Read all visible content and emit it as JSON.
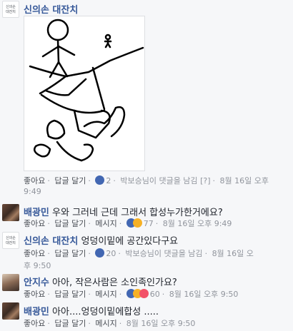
{
  "comments": [
    {
      "author": "신의손 대잔치",
      "avatar_text": "신의손\n대잔치",
      "actions": {
        "like": "좋아요",
        "reply": "답글 달기",
        "reactions_count": "2",
        "reply_summary": "박보승님이 댓글을 남김",
        "reply_summary_tag": "[?]",
        "time": "8월 16일 오후",
        "time_cont": "9:49"
      }
    },
    {
      "author": "배광민",
      "text": "우와 그러네 근데 그래서 합성누가한거에요?",
      "actions": {
        "like": "좋아요",
        "reply": "답글 달기",
        "message": "메시지",
        "reactions_count": "77",
        "time": "8월 16일 오후 9:49"
      }
    },
    {
      "author": "신의손 대잔치",
      "avatar_text": "신의손\n대잔치",
      "text": "엉덩이밑에 공간있다구요",
      "actions": {
        "like": "좋아요",
        "reply": "답글 달기",
        "reactions_count": "20",
        "reply_summary": "박보승님이 댓글을 남김",
        "time": "8월 16일 오",
        "time_cont": "후 9:50"
      }
    },
    {
      "author": "안지수",
      "text": "아아, 작은사람은 소인족인가요?",
      "actions": {
        "like": "좋아요",
        "reply": "답글 달기",
        "message": "메시지",
        "reactions_count": "60",
        "time": "8월 16일 오후 9:50"
      }
    },
    {
      "author": "배광민",
      "text": "아아....엉덩이밑에합성 .....",
      "actions": {
        "like": "좋아요",
        "reply": "답글 달기",
        "message": "메시지",
        "time": "8월 16일 오후 9:50"
      }
    }
  ]
}
